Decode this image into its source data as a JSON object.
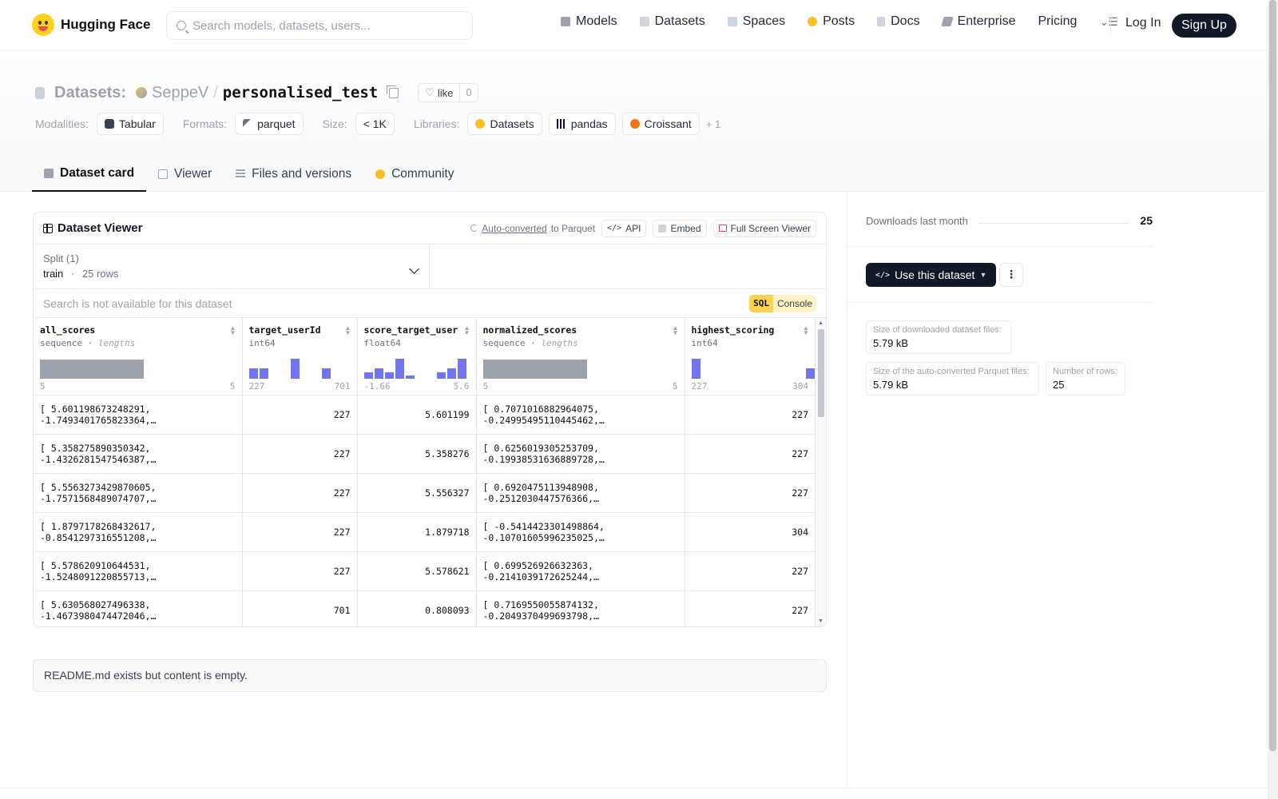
{
  "header": {
    "brand": "Hugging Face",
    "search_placeholder": "Search models, datasets, users...",
    "nav": [
      {
        "label": "Models",
        "color": "#9ca3af"
      },
      {
        "label": "Datasets",
        "color": "#d1d5db"
      },
      {
        "label": "Spaces",
        "color": "#cbd5e1"
      },
      {
        "label": "Posts",
        "color": "#fbbf24"
      },
      {
        "label": "Docs",
        "color": "#cbd5e1"
      },
      {
        "label": "Enterprise",
        "color": "#9ca3af"
      },
      {
        "label": "Pricing"
      }
    ],
    "login": "Log In",
    "signup": "Sign Up"
  },
  "dataset": {
    "type_label": "Datasets:",
    "owner": "SeppeV",
    "name": "personalised_test",
    "like_label": "like",
    "like_count": "0",
    "modalities_label": "Modalities:",
    "modality": "Tabular",
    "formats_label": "Formats:",
    "format": "parquet",
    "size_label": "Size:",
    "size": "< 1K",
    "libraries_label": "Libraries:",
    "libraries": [
      "Datasets",
      "pandas",
      "Croissant"
    ],
    "libraries_more": "+ 1"
  },
  "tabs": [
    "Dataset card",
    "Viewer",
    "Files and versions",
    "Community"
  ],
  "viewer": {
    "title": "Dataset Viewer",
    "auto_converted": "Auto-converted",
    "to_parquet": "to Parquet",
    "api": "API",
    "embed": "Embed",
    "full_screen": "Full Screen Viewer",
    "split_label": "Split (1)",
    "split_value": "train",
    "split_sep": "·",
    "split_rows": "25 rows",
    "search_placeholder": "Search is not available for this dataset",
    "sql": "SQL",
    "console": "Console",
    "columns": [
      {
        "name": "all_scores",
        "type": "sequence",
        "sub": "lengths",
        "min": "5",
        "max": "5",
        "hist_kind": "gray"
      },
      {
        "name": "target_userId",
        "type": "int64",
        "sub": "",
        "min": "227",
        "max": "701",
        "hist": [
          0.45,
          0.45,
          0,
          0,
          0.9,
          0,
          0,
          0.45
        ]
      },
      {
        "name": "score_target_user",
        "type": "float64",
        "sub": "",
        "min": "-1.66",
        "max": "5.6",
        "hist": [
          0.3,
          0.45,
          0.3,
          0.9,
          0.15,
          0,
          0,
          0.3,
          0.45,
          0.9
        ]
      },
      {
        "name": "normalized_scores",
        "type": "sequence",
        "sub": "lengths",
        "min": "5",
        "max": "5",
        "hist_kind": "gray"
      },
      {
        "name": "highest_scoring",
        "type": "int64",
        "sub": "",
        "min": "227",
        "max": "304",
        "hist": [
          0.9,
          0,
          0,
          0,
          0,
          0,
          0,
          0,
          0,
          0,
          0,
          0.45
        ]
      }
    ],
    "rows": [
      {
        "all_scores": [
          "[ 5.601198673248291,",
          "-1.7493401765823364,…"
        ],
        "target_userId": "227",
        "score_target_user": "5.601199",
        "normalized_scores": [
          "[ 0.7071016882964075,",
          "-0.24995495110445462,…"
        ],
        "highest_scoring": "227"
      },
      {
        "all_scores": [
          "[ 5.358275890350342,",
          "-1.4326281547546387,…"
        ],
        "target_userId": "227",
        "score_target_user": "5.358276",
        "normalized_scores": [
          "[ 0.6256019305253709,",
          "-0.19938531636889728,…"
        ],
        "highest_scoring": "227"
      },
      {
        "all_scores": [
          "[ 5.5563273429870605,",
          "-1.7571568489074707,…"
        ],
        "target_userId": "227",
        "score_target_user": "5.556327",
        "normalized_scores": [
          "[ 0.6920475113948908,",
          "-0.2512030447576366,…"
        ],
        "highest_scoring": "227"
      },
      {
        "all_scores": [
          "[ 1.8797178268432617,",
          "-0.8541297316551208,…"
        ],
        "target_userId": "227",
        "score_target_user": "1.879718",
        "normalized_scores": [
          "[ -0.5414423301498864,",
          "-0.10701605996235025,…"
        ],
        "highest_scoring": "304"
      },
      {
        "all_scores": [
          "[ 5.578620910644531,",
          "-1.5248091220855713,…"
        ],
        "target_userId": "227",
        "score_target_user": "5.578621",
        "normalized_scores": [
          "[ 0.699526926632363,",
          "-0.2141039172625244,…"
        ],
        "highest_scoring": "227"
      },
      {
        "all_scores": [
          "[ 5.630568027496338,",
          "-1.4673980474472046,…"
        ],
        "target_userId": "701",
        "score_target_user": "0.808093",
        "normalized_scores": [
          "[ 0.7169550055874132,",
          "-0.2049370499693798,…"
        ],
        "highest_scoring": "227"
      }
    ]
  },
  "readme_text": "README.md exists but content is empty.",
  "sidebar": {
    "downloads_label": "Downloads last month",
    "downloads_value": "25",
    "use_dataset": "Use this dataset",
    "stats": [
      {
        "label": "Size of downloaded dataset files:",
        "value": "5.79 kB"
      },
      {
        "label": "Size of the auto-converted Parquet files:",
        "value": "5.79 kB"
      },
      {
        "label": "Number of rows:",
        "value": "25"
      }
    ]
  }
}
